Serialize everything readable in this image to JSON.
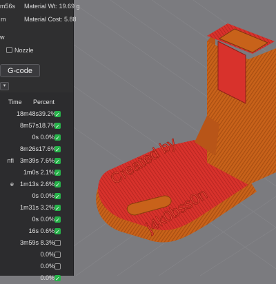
{
  "stats": {
    "time_fragment": "m56s",
    "material_weight": "Material Wt: 19.69 g",
    "unit_fragment": "m",
    "material_cost": "Material Cost: 5.88",
    "w_fragment": "w",
    "nozzle_label": "Nozzle",
    "nozzle_checked": false
  },
  "gcode_button": "G-code",
  "dropdown_glyph": "▾",
  "table": {
    "headers": [
      "Time",
      "Percent"
    ],
    "rows": [
      {
        "name": "",
        "time": "18m48s",
        "percent": "39.2%",
        "checked": true
      },
      {
        "name": "",
        "time": "8m57s",
        "percent": "18.7%",
        "checked": true
      },
      {
        "name": "",
        "time": "0s",
        "percent": "0.0%",
        "checked": true
      },
      {
        "name": "",
        "time": "8m26s",
        "percent": "17.6%",
        "checked": true
      },
      {
        "name": "nfi",
        "time": "3m39s",
        "percent": "7.6%",
        "checked": true
      },
      {
        "name": "",
        "time": "1m0s",
        "percent": "2.1%",
        "checked": true
      },
      {
        "name": "e",
        "time": "1m13s",
        "percent": "2.6%",
        "checked": true
      },
      {
        "name": "",
        "time": "0s",
        "percent": "0.0%",
        "checked": true
      },
      {
        "name": "",
        "time": "1m31s",
        "percent": "3.2%",
        "checked": true
      },
      {
        "name": "",
        "time": "0s",
        "percent": "0.0%",
        "checked": true
      },
      {
        "name": "",
        "time": "16s",
        "percent": "0.6%",
        "checked": true
      },
      {
        "name": "",
        "time": "3m59s",
        "percent": "8.3%",
        "checked": false
      },
      {
        "name": "",
        "time": "",
        "percent": "0.0%",
        "checked": false
      },
      {
        "name": "",
        "time": "",
        "percent": "0.0%",
        "checked": false
      },
      {
        "name": "",
        "time": "",
        "percent": "0.0%",
        "checked": true
      }
    ]
  },
  "model": {
    "engraving_line1": "Created by",
    "engraving_line2": "j4k0bss0n"
  },
  "colors": {
    "model_orange": "#c8621a",
    "model_red": "#d8322c",
    "grid": "#8a8a8e",
    "check_green": "#27b24a"
  }
}
